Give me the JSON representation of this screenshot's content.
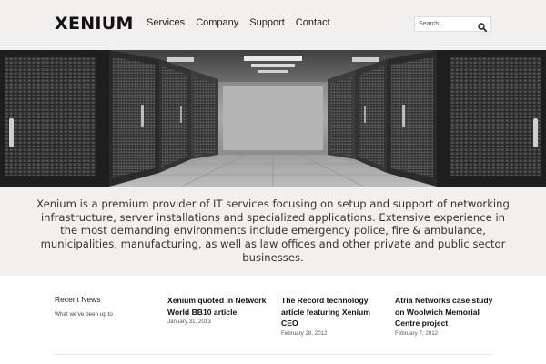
{
  "header": {
    "logo": "XENIUM",
    "nav": [
      "Services",
      "Company",
      "Support",
      "Contact"
    ],
    "search_placeholder": "Search..."
  },
  "intro": {
    "text": "Xenium is a premium provider of IT services focusing on setup and support of networking infrastructure, server installations and specialized applications. Extensive experience in the most demanding environments include emergency police, fire & ambulance, municipalities, manufacturing, as well as law offices and other private and public sector businesses."
  },
  "news": {
    "title": "Recent News",
    "subtitle": "What we've been up to",
    "articles": [
      {
        "title": "Xenium quoted in Network World BB10 article",
        "date": "January 31, 2013"
      },
      {
        "title": "The Record technology article featuring Xenium CEO",
        "date": "February 28, 2012"
      },
      {
        "title": "Atria Networks case study on Woolwich Memorial Centre project",
        "date": "February 7, 2012"
      }
    ]
  },
  "colors": {
    "band_background": "#f2f0ef",
    "text_dark": "#111111"
  },
  "icons": {
    "search": "search-icon"
  }
}
